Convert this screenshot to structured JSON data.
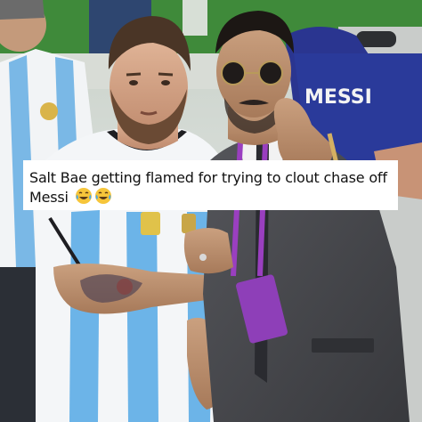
{
  "caption": {
    "text": "Salt Bae getting flamed for trying to clout chase off Messi",
    "emojis": [
      "face-with-tears-of-joy-icon",
      "face-with-tears-of-joy-icon"
    ]
  },
  "photo": {
    "jersey_name": "MESSI"
  },
  "colors": {
    "jersey_blue": "#6cb4e8",
    "jersey_white": "#f4f6f8",
    "caption_bg": "#ffffff",
    "badge_purple": "#8e3fb8",
    "suit_gray": "#4a4a4f",
    "pitch_green": "#3f8a3a"
  }
}
